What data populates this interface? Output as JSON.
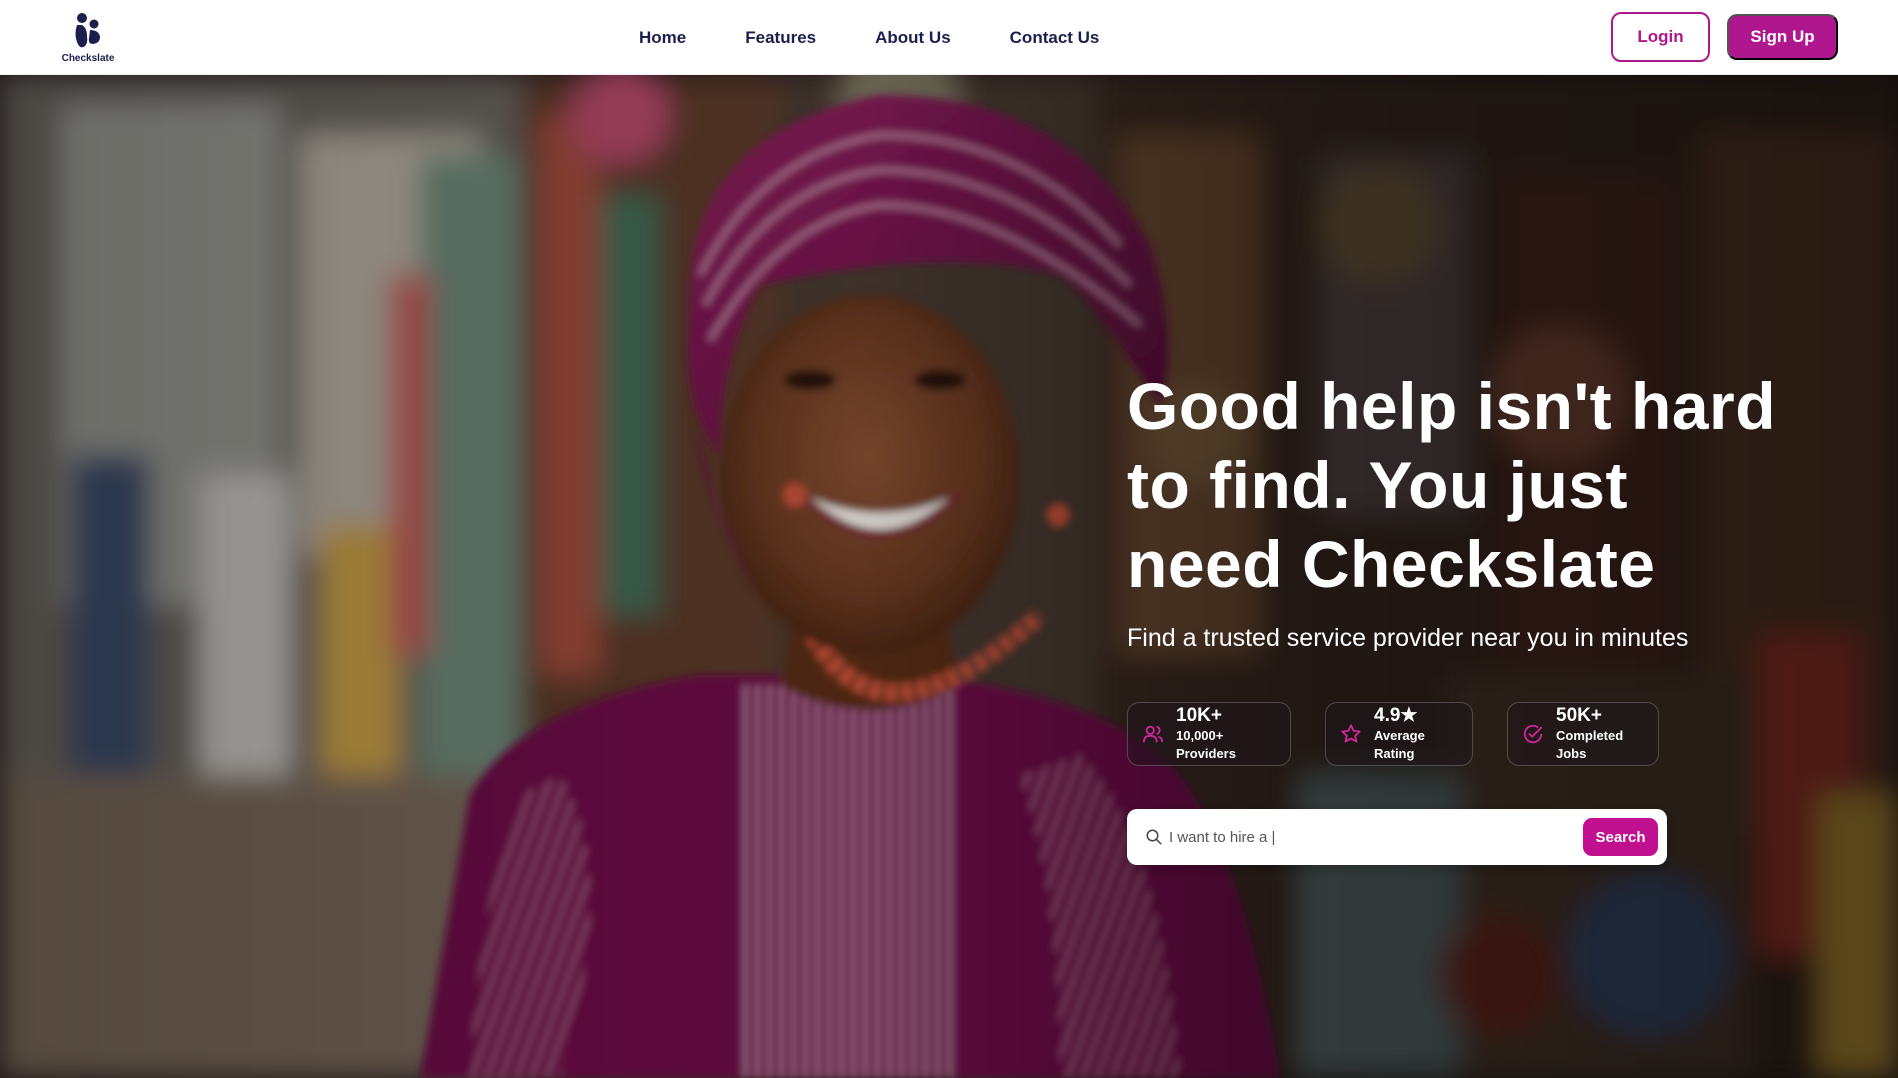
{
  "brand": {
    "name": "Checkslate",
    "accent": "#b0178e",
    "navy": "#1b1f4b"
  },
  "nav": {
    "links": [
      "Home",
      "Features",
      "About Us",
      "Contact Us"
    ],
    "login_label": "Login",
    "signup_label": "Sign Up"
  },
  "hero": {
    "headline_lines": [
      "Good help isn't hard",
      "to find. You just",
      "need Checkslate"
    ],
    "subheadline": "Find a trusted service provider near you in minutes",
    "stats": [
      {
        "value": "10K+",
        "label": "10,000+ Providers",
        "icon": "users-icon"
      },
      {
        "value": "4.9★",
        "label": "Average Rating",
        "icon": "star-icon"
      },
      {
        "value": "50K+",
        "label": "Completed Jobs",
        "icon": "check-circle-icon"
      }
    ],
    "search": {
      "placeholder": "I want to hire a |",
      "value": "",
      "button_label": "Search"
    }
  }
}
